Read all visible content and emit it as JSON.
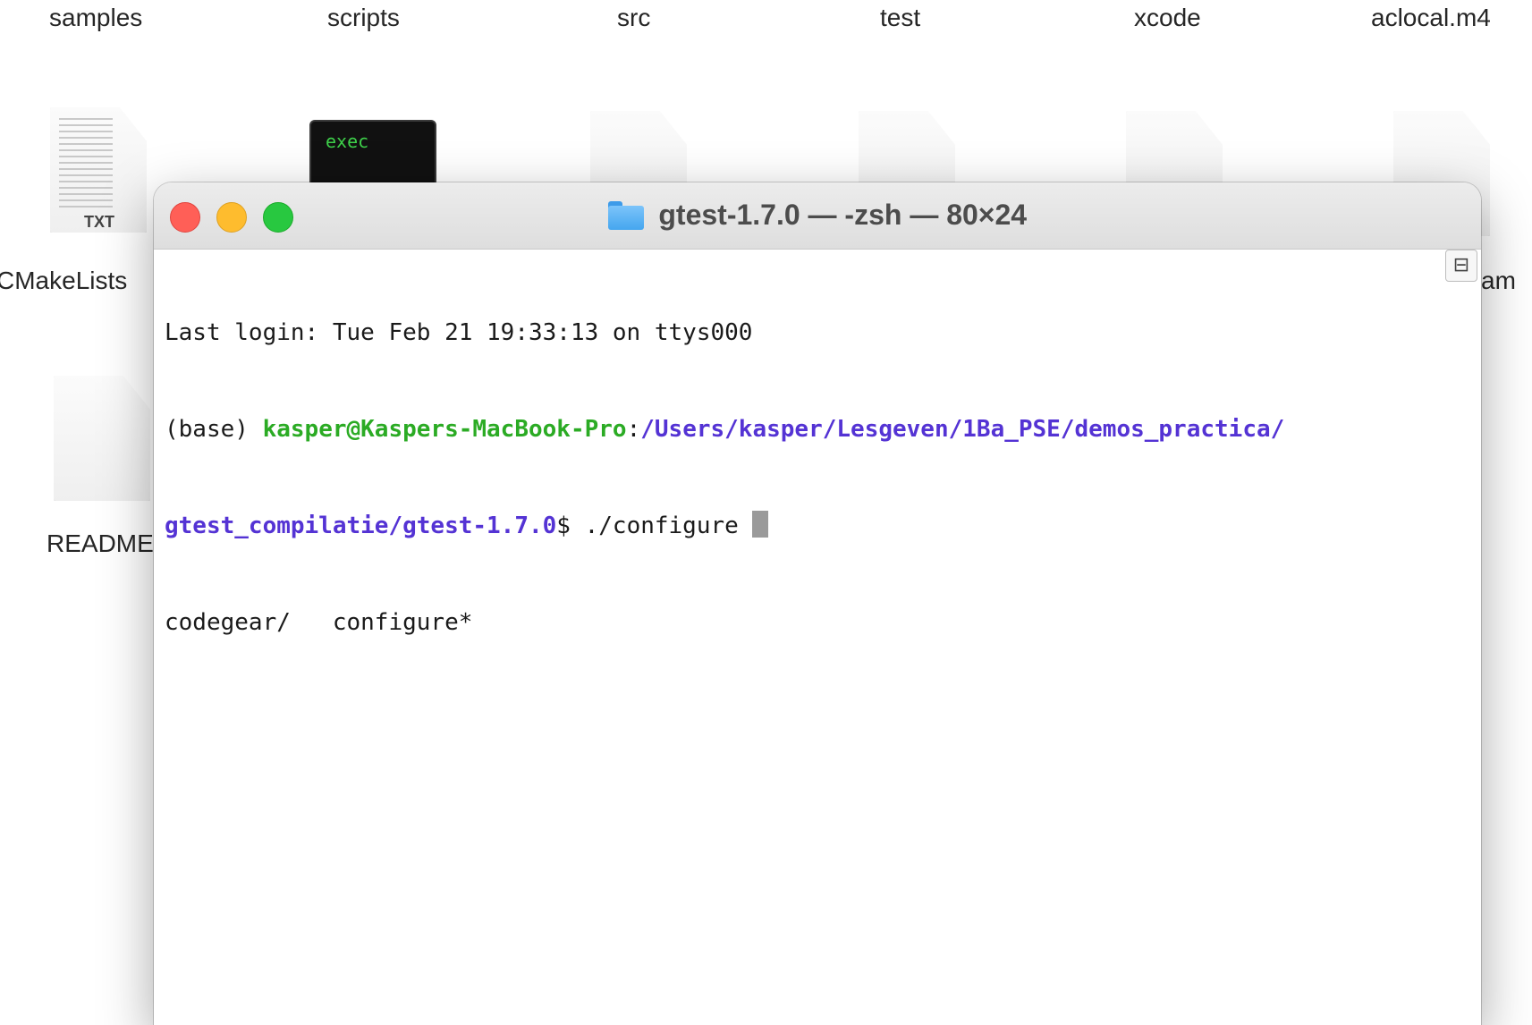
{
  "finder": {
    "top_labels": [
      "samples",
      "scripts",
      "src",
      "test",
      "xcode",
      "aclocal.m4"
    ],
    "txt_badge": "TXT",
    "exec_label": "exec",
    "left_labels": [
      "CMakeLists",
      "README"
    ],
    "right_partial": "am"
  },
  "terminal": {
    "title": "gtest-1.7.0 — -zsh — 80×24",
    "last_login": "Last login: Tue Feb 21 19:33:13 on ttys000",
    "prompt_prefix": "(base) ",
    "prompt_user": "kasper@Kaspers-MacBook-Pro",
    "prompt_sep": ":",
    "prompt_path_1": "/Users/kasper/Lesgeven/1Ba_PSE/demos_practica/",
    "prompt_path_2": "gtest_compilatie/gtest-1.7.0",
    "prompt_suffix": "$ ",
    "command": "./configure ",
    "completions": "codegear/   configure*",
    "colors": {
      "user": "#2bab24",
      "path": "#5433d4",
      "close": "#ff5f57",
      "minimize": "#febc2e",
      "zoom": "#28c840"
    }
  }
}
